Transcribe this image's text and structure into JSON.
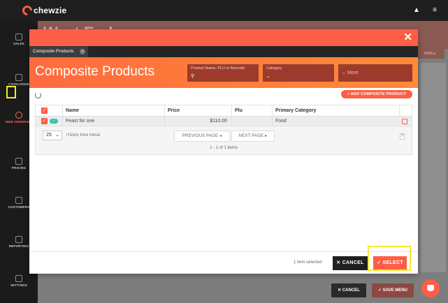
{
  "app": {
    "name": "chewzie"
  },
  "topbar": {
    "icons": [
      "bell-icon",
      "menu-icon"
    ]
  },
  "sidebar": {
    "items": [
      {
        "label": "SALES",
        "icon": "sales-icon"
      },
      {
        "label": "CATALOGUE",
        "icon": "catalogue-icon"
      },
      {
        "label": "WEB ORDERING",
        "icon": "web-ordering-icon",
        "active": true
      },
      {
        "label": "PRICING",
        "icon": "pricing-icon"
      },
      {
        "label": "CUSTOMERS",
        "icon": "customers-icon"
      },
      {
        "label": "REPORTING",
        "icon": "reporting-icon"
      },
      {
        "label": "SETTINGS",
        "icon": "settings-icon"
      }
    ]
  },
  "background": {
    "title": "Wast End",
    "right_tab": "IONS ▾",
    "cancel_label": "✕ CANCEL",
    "save_label": "✓ SAVE MENU"
  },
  "modal": {
    "close_icon": "close-icon",
    "tab_label": "Composite Products",
    "title": "Composite Products",
    "filters": {
      "search_label": "Product Name, PLU or Barcode",
      "category_label": "Category",
      "more_label": "More"
    },
    "add_button": "+ ADD COMPOSITE PRODUCT",
    "table": {
      "columns": [
        "Name",
        "Price",
        "Plu",
        "Primary Category"
      ],
      "rows": [
        {
          "name": "Feast for one",
          "price": "$110.00",
          "plu": "",
          "category": "Food"
        }
      ]
    },
    "pager": {
      "per_page": "25",
      "per_page_label": "ITEMS PER PAGE",
      "prev_label": "PREVIOUS PAGE ◂",
      "next_label": "NEXT PAGE ▸",
      "info": "1 - 1 of 1 items"
    },
    "footer": {
      "selected_count": "1 item selected",
      "cancel_label": "✕ CANCEL",
      "select_label": "✓ SELECT"
    }
  },
  "colors": {
    "accent": "#ff5e46",
    "highlight": "#f6ea2e",
    "dark": "#1f1f1f"
  }
}
